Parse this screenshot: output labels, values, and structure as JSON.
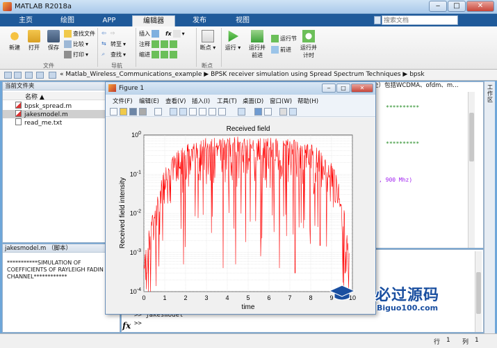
{
  "app": {
    "title": "MATLAB R2018a"
  },
  "ribbon_tabs": [
    "主页",
    "绘图",
    "APP",
    "编辑器",
    "发布",
    "视图"
  ],
  "search": {
    "placeholder": "搜索文档"
  },
  "ribbon": {
    "file": {
      "new": "新建",
      "open": "打开",
      "save": "保存",
      "find_files": "查找文件",
      "compare": "比较",
      "print": "打印",
      "group": "文件"
    },
    "navigate": {
      "go_to": "转至",
      "find": "查找",
      "group": "导航"
    },
    "edit": {
      "insert": "插入",
      "comment": "注释",
      "indent": "缩进",
      "fx": "fx"
    },
    "breakpoints": {
      "label": "断点",
      "group": "断点"
    },
    "run": {
      "run": "运行",
      "run_advance_l1": "运行并",
      "run_advance_l2": "前进",
      "run_section": "运行节",
      "advance": "前进",
      "run_time_l1": "运行并",
      "run_time_l2": "计时"
    }
  },
  "address": {
    "path": "« Matlab_Wireless_Communications_example ▶ BPSK receiver simulation using Spread Spectrum Techniques ▶ bpsk"
  },
  "current_folder": {
    "title": "当前文件夹",
    "column": "名称 ▲",
    "files": [
      "bpsk_spread.m",
      "jakesmodel.m",
      "read_me.txt"
    ]
  },
  "details": {
    "title": "jakesmodel.m （脚本）",
    "text": "***********SIMULATION OF\nCOEFFICIENTS OF RAYLEIGH FADIN\nCHANNEL************"
  },
  "editor": {
    "header": "全）包括WCDMA、ofdm、m…",
    "lines": [
      "**********",
      "**********",
      ", 900 Mhz)"
    ]
  },
  "command": {
    "lines": [
      ">> jakesmodel",
      ">>"
    ],
    "fx": "fx"
  },
  "workspace_tab": "工作区",
  "status": {
    "row_label": "行",
    "row": "1",
    "col_label": "列",
    "col": "1"
  },
  "figure": {
    "title": "Figure 1",
    "menu": [
      "文件(F)",
      "编辑(E)",
      "查看(V)",
      "插入(I)",
      "工具(T)",
      "桌面(D)",
      "窗口(W)",
      "帮助(H)"
    ]
  },
  "chart_data": {
    "type": "line",
    "title": "Received field",
    "xlabel": "time",
    "ylabel": "Received field intensity",
    "xlim": [
      0,
      10
    ],
    "ylim": [
      0.0001,
      1
    ],
    "yscale": "log",
    "xticks": [
      "0",
      "1",
      "2",
      "3",
      "4",
      "5",
      "6",
      "7",
      "8",
      "9",
      "10"
    ],
    "yticks": [
      "10^0",
      "10^-1",
      "10^-2",
      "10^-3",
      "10^-4"
    ],
    "grid": true,
    "series": [
      {
        "color": "#ff0000",
        "envelope": [
          [
            0.0,
            0.0006
          ],
          [
            0.2,
            0.003
          ],
          [
            0.5,
            0.015
          ],
          [
            0.8,
            0.06
          ],
          [
            1.0,
            0.15
          ],
          [
            1.5,
            0.35
          ],
          [
            2.0,
            0.6
          ],
          [
            2.5,
            0.75
          ],
          [
            3.0,
            0.85
          ],
          [
            4.0,
            0.9
          ],
          [
            5.0,
            0.92
          ],
          [
            6.0,
            0.88
          ],
          [
            7.0,
            0.8
          ],
          [
            8.0,
            0.6
          ],
          [
            8.5,
            0.42
          ],
          [
            9.0,
            0.2
          ],
          [
            9.3,
            0.08
          ],
          [
            9.6,
            0.012
          ],
          [
            9.85,
            0.001
          ]
        ],
        "deep_fades": [
          [
            0.15,
            0.0003
          ],
          [
            0.9,
            0.002
          ],
          [
            1.9,
            0.0005
          ],
          [
            3.8,
            0.0004
          ],
          [
            4.4,
            0.0005
          ],
          [
            5.6,
            0.0008
          ],
          [
            6.5,
            0.0004
          ],
          [
            7.25,
            0.0003
          ],
          [
            8.45,
            0.0015
          ],
          [
            9.65,
            0.0003
          ]
        ]
      }
    ]
  },
  "watermark": {
    "cn": "必过源码",
    "en": "Biguo100.com"
  }
}
